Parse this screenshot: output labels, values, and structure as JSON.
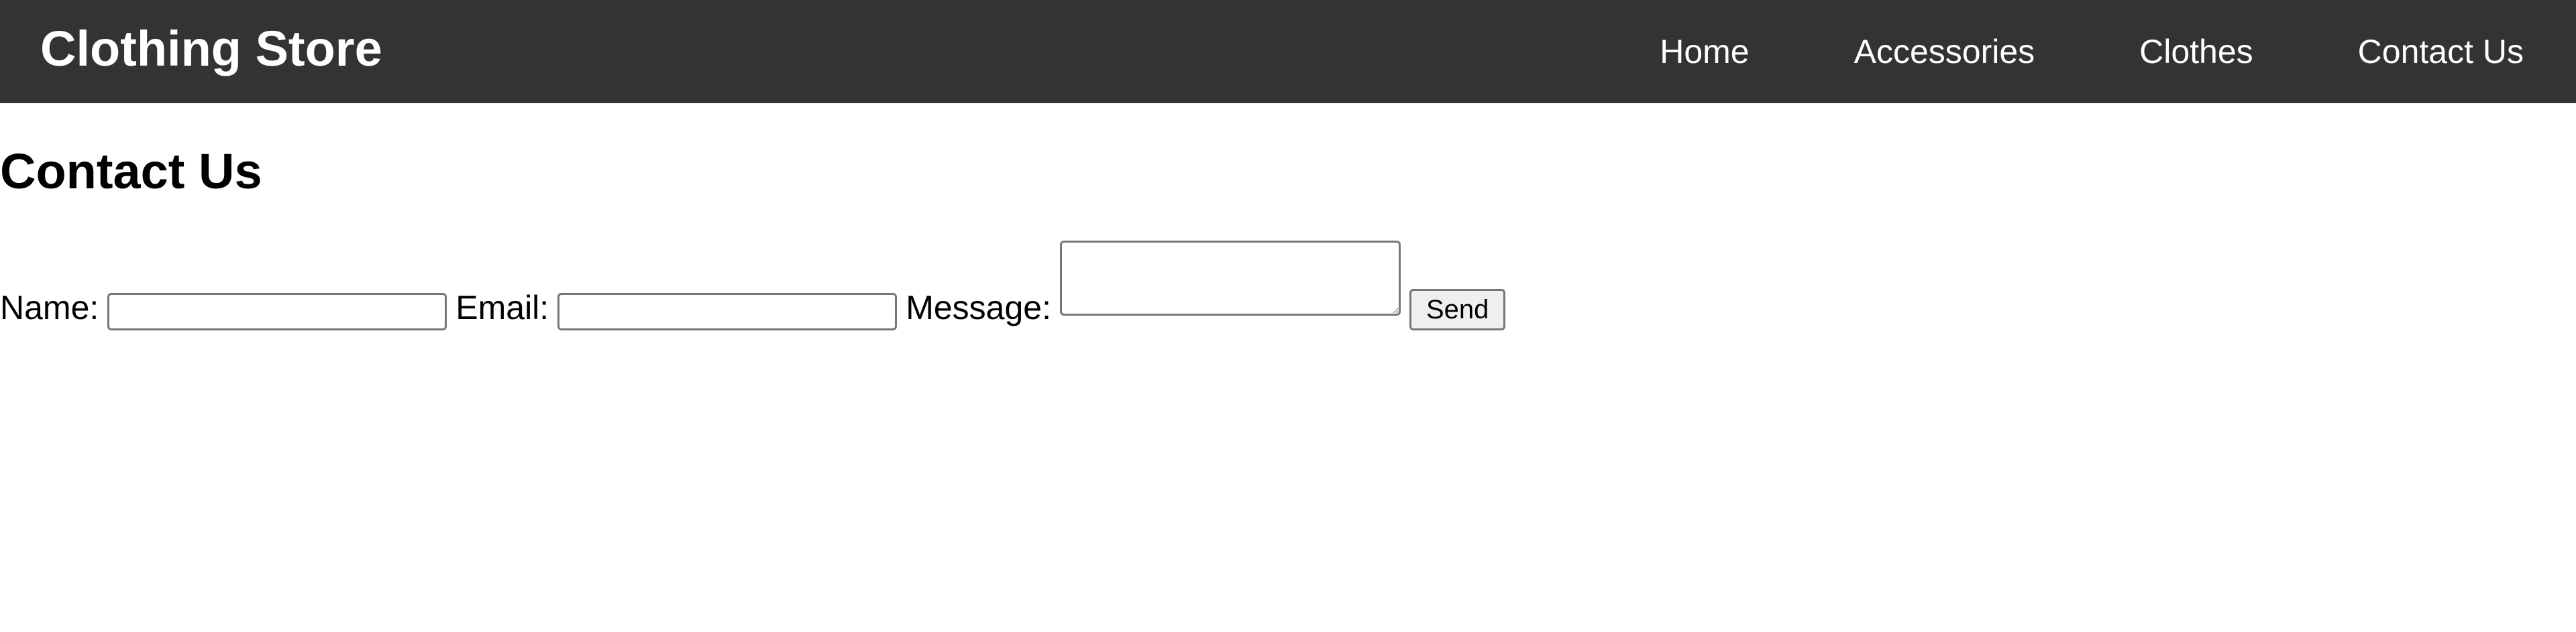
{
  "header": {
    "brand": "Clothing Store",
    "nav": [
      {
        "label": "Home"
      },
      {
        "label": "Accessories"
      },
      {
        "label": "Clothes"
      },
      {
        "label": "Contact Us"
      }
    ],
    "background_color": "#333333",
    "text_color": "#ffffff"
  },
  "main": {
    "title": "Contact Us",
    "form": {
      "name_label": "Name:",
      "name_value": "",
      "email_label": "Email:",
      "email_value": "",
      "message_label": "Message:",
      "message_value": "",
      "send_label": "Send"
    }
  }
}
